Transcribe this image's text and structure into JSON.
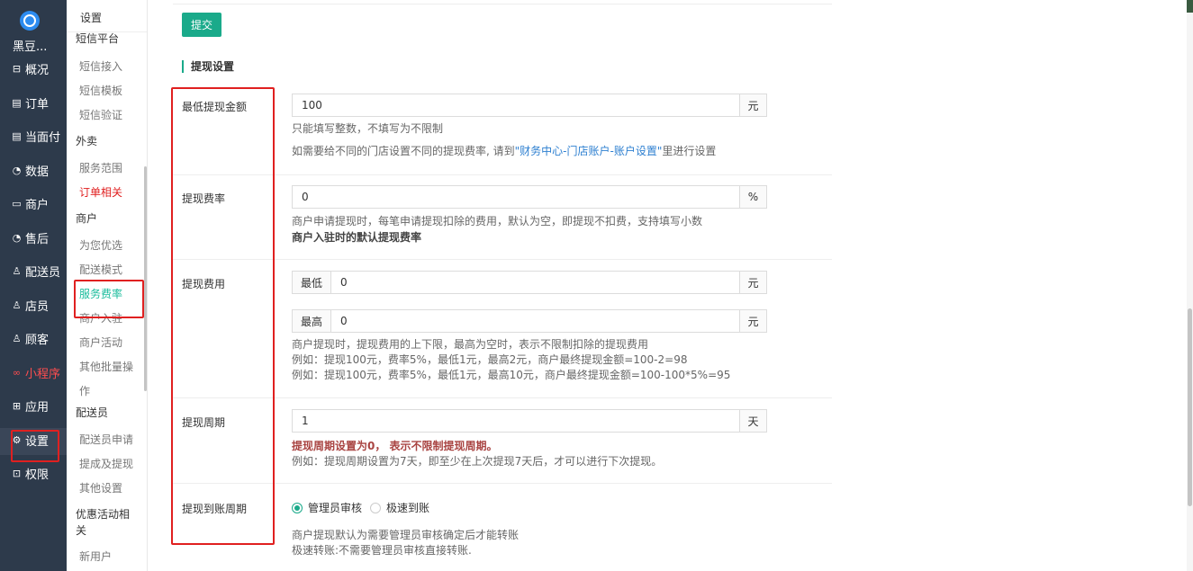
{
  "nav": {
    "brand": "黑豆...",
    "items": [
      {
        "label": "概况",
        "icon": "⊟"
      },
      {
        "label": "订单",
        "icon": "▤"
      },
      {
        "label": "当面付",
        "icon": "▤"
      },
      {
        "label": "数据",
        "icon": "◔"
      },
      {
        "label": "商户",
        "icon": "▭"
      },
      {
        "label": "售后",
        "icon": "◔"
      },
      {
        "label": "配送员",
        "icon": "♙"
      },
      {
        "label": "店员",
        "icon": "♙"
      },
      {
        "label": "顾客",
        "icon": "♙"
      },
      {
        "label": "小程序",
        "icon": "∞"
      },
      {
        "label": "应用",
        "icon": "⊞"
      },
      {
        "label": "设置",
        "icon": "⚙"
      },
      {
        "label": "权限",
        "icon": "⊡"
      }
    ]
  },
  "subnav": {
    "title": "设置",
    "groups": {
      "sms": "短信平台",
      "takeout": "外卖",
      "merchant": "商户",
      "courier": "配送员",
      "promo_line1": "优惠活动相",
      "promo_line2": "关"
    },
    "items": {
      "sms_access": "短信接入",
      "sms_template": "短信模板",
      "sms_verify": "短信验证",
      "service_area": "服务范围",
      "order_related": "订单相关",
      "recommend": "为您优选",
      "delivery_mode": "配送模式",
      "service_rate": "服务费率",
      "merchant_join": "商户入驻",
      "merchant_activity": "商户活动",
      "batch_line1": "其他批量操",
      "batch_line2": "作",
      "courier_apply": "配送员申请",
      "commission": "提成及提现",
      "other_settings": "其他设置",
      "new_user": "新用户"
    }
  },
  "main": {
    "submit_label": "提交",
    "section_title": "提现设置",
    "min_amount": {
      "label": "最低提现金额",
      "value": "100",
      "unit": "元",
      "help1": "只能填写整数，不填写为不限制",
      "help2_pre": "如需要给不同的门店设置不同的提现费率, 请到",
      "help2_link": "\"财务中心-门店账户-账户设置\"",
      "help2_post": "里进行设置"
    },
    "fee_rate": {
      "label": "提现费率",
      "value": "0",
      "unit": "%",
      "help1": "商户申请提现时，每笔申请提现扣除的费用，默认为空，即提现不扣费，支持填写小数",
      "help2": "商户入驻时的默认提现费率"
    },
    "fee": {
      "label": "提现费用",
      "min_prefix": "最低",
      "min_value": "0",
      "max_prefix": "最高",
      "max_value": "0",
      "unit": "元",
      "help1": "商户提现时，提现费用的上下限，最高为空时，表示不限制扣除的提现费用",
      "help2": "例如：提现100元，费率5%，最低1元，最高2元，商户最终提现金额=100-2=98",
      "help3": "例如：提现100元，费率5%，最低1元，最高10元，商户最终提现金额=100-100*5%=95"
    },
    "period": {
      "label": "提现周期",
      "value": "1",
      "unit": "天",
      "help1": "提现周期设置为0， 表示不限制提现周期。",
      "help2": "例如：提现周期设置为7天，即至少在上次提现7天后，才可以进行下次提现。"
    },
    "arrival": {
      "label": "提现到账周期",
      "option1": "管理员审核",
      "option2": "极速到账",
      "help1": "商户提现默认为需要管理员审核确定后才能转账",
      "help2": "极速转账:不需要管理员审核直接转账."
    }
  }
}
